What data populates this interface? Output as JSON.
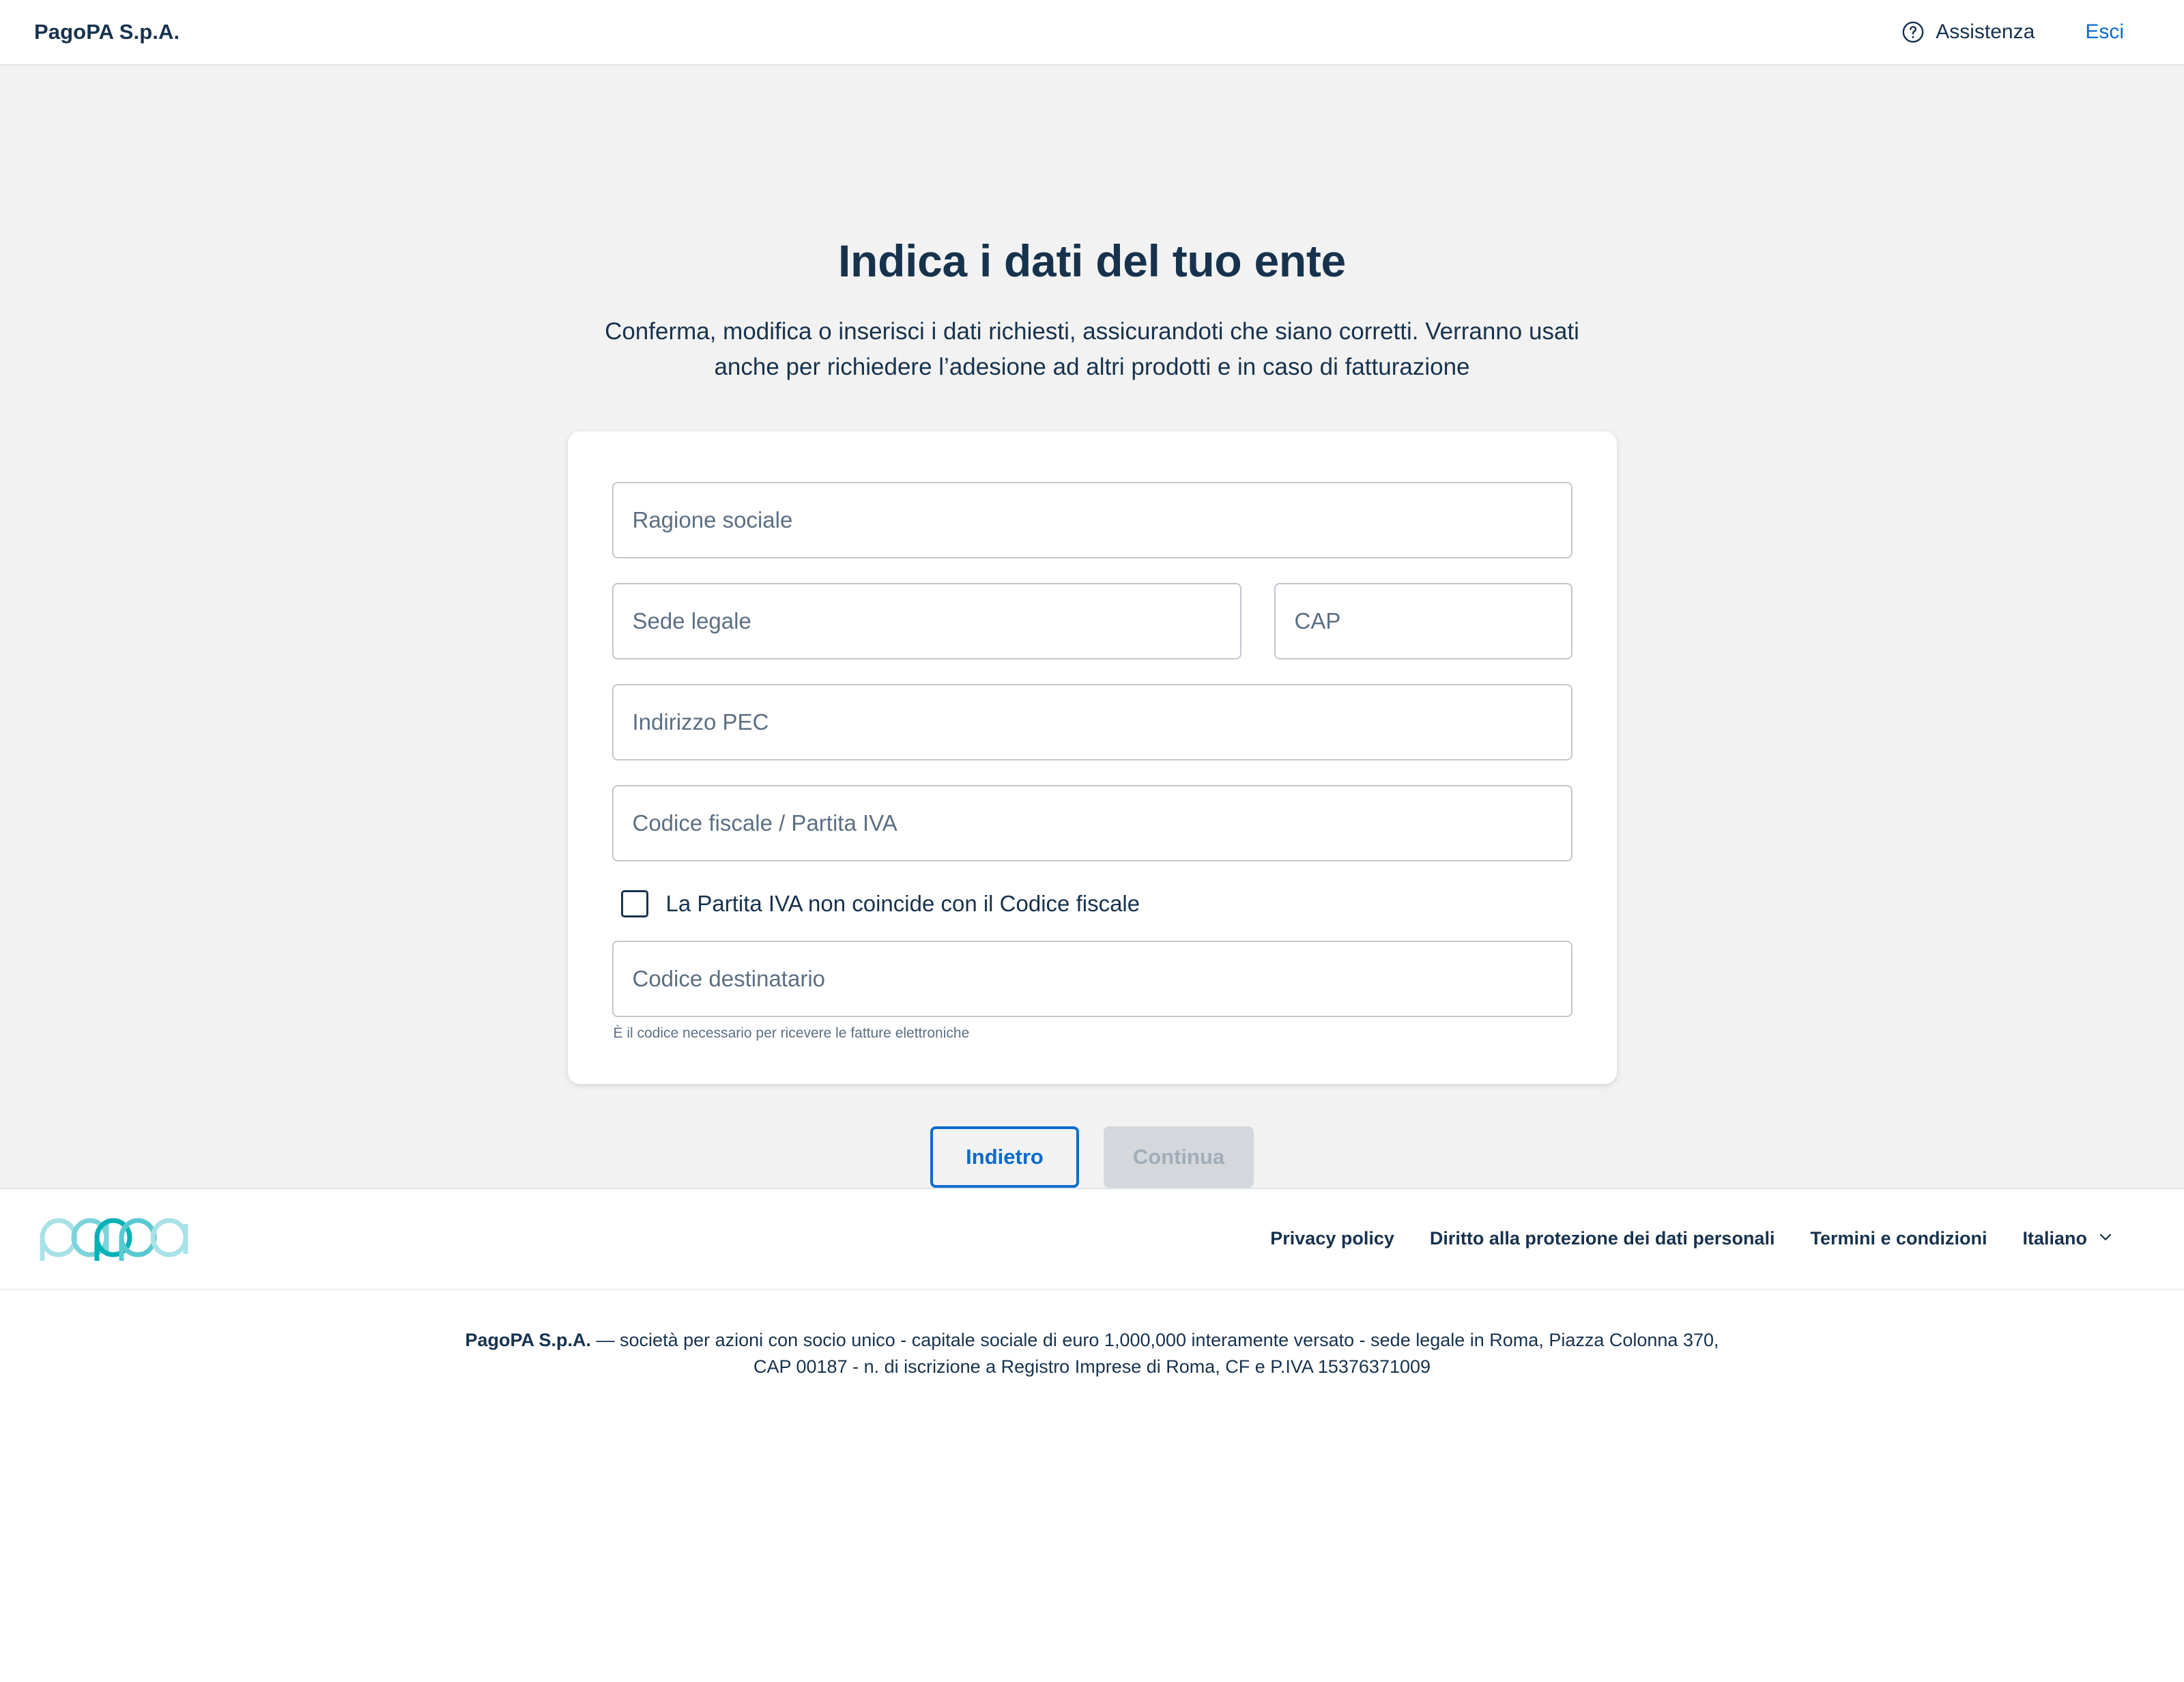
{
  "header": {
    "brand": "PagoPA S.p.A.",
    "assistance_label": "Assistenza",
    "assistance_icon": "help-circle-icon",
    "logout_label": "Esci"
  },
  "main": {
    "title": "Indica i dati del tuo ente",
    "subtitle": "Conferma, modifica o inserisci i dati richiesti, assicurandoti che siano corretti. Verranno usati anche per richiedere l’adesione ad altri prodotti e in caso di fatturazione"
  },
  "form": {
    "fields": [
      {
        "name": "ragione-sociale",
        "placeholder": "Ragione sociale",
        "value": ""
      },
      {
        "name": "sede-legale",
        "placeholder": "Sede legale",
        "value": ""
      },
      {
        "name": "cap",
        "placeholder": "CAP",
        "value": ""
      },
      {
        "name": "indirizzo-pec",
        "placeholder": "Indirizzo PEC",
        "value": ""
      },
      {
        "name": "codice-fiscale-partita-iva",
        "placeholder": "Codice fiscale / Partita IVA",
        "value": ""
      },
      {
        "name": "codice-destinatario",
        "placeholder": "Codice destinatario",
        "value": ""
      }
    ],
    "checkbox": {
      "label": "La Partita IVA non coincide con il Codice fiscale",
      "checked": false
    },
    "helper_text": "È il codice necessario per ricevere le fatture elettroniche"
  },
  "actions": {
    "back_label": "Indietro",
    "continue_label": "Continua",
    "continue_disabled": true
  },
  "footer": {
    "logo_text": "pagopa",
    "links": [
      "Privacy policy",
      "Diritto alla protezione dei dati personali",
      "Termini e condizioni"
    ],
    "language": "Italiano",
    "language_icon": "chevron-down-icon",
    "legal_line1_bold": "PagoPA S.p.A.",
    "legal_line1_rest": " — società per azioni con socio unico - capitale sociale di euro 1,000,000 interamente versato - sede legale in Roma, Piazza Colonna 370,",
    "legal_line2": "CAP 00187 - n. di iscrizione a Registro Imprese di Roma, CF e P.IVA 15376371009"
  },
  "colors": {
    "page_bg": "#F2F2F2",
    "text_primary": "#17324D",
    "text_muted": "#5C6F82",
    "accent_blue": "#0B6BCB",
    "logo_teal": "#00B1B5",
    "border": "#C2C7CE"
  }
}
